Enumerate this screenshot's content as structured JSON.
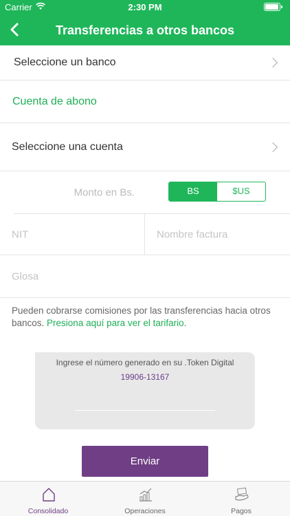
{
  "status": {
    "carrier": "Carrier",
    "time": "2:30 PM",
    "battery_level": 1.0
  },
  "nav": {
    "title": "Transferencias a otros bancos"
  },
  "form": {
    "bank_select": "Seleccione un banco",
    "section_label": "Cuenta de abono",
    "account_select": "Seleccione una cuenta",
    "amount_placeholder": "Monto en Bs.",
    "currency": {
      "options": [
        "BS",
        "$US"
      ],
      "selected": "BS"
    },
    "nit_placeholder": "NIT",
    "invoice_name_placeholder": "Nombre factura",
    "glosa_placeholder": "Glosa"
  },
  "note": {
    "text": "Pueden cobrarse comisiones por las transferencias hacia otros bancos. ",
    "link": "Presiona aquí para ver el tarifario",
    "end": "."
  },
  "token": {
    "hint": "Ingrese el número generado en su .Token Digital",
    "generated": "19906-13167"
  },
  "send_label": "Enviar",
  "tabs": [
    {
      "label": "Consolidado",
      "icon": "home-icon",
      "active": true
    },
    {
      "label": "Operaciones",
      "icon": "chart-icon",
      "active": false
    },
    {
      "label": "Pagos",
      "icon": "payments-icon",
      "active": false
    }
  ],
  "colors": {
    "brand_green": "#1fb65a",
    "accent_purple": "#6f3e85"
  }
}
